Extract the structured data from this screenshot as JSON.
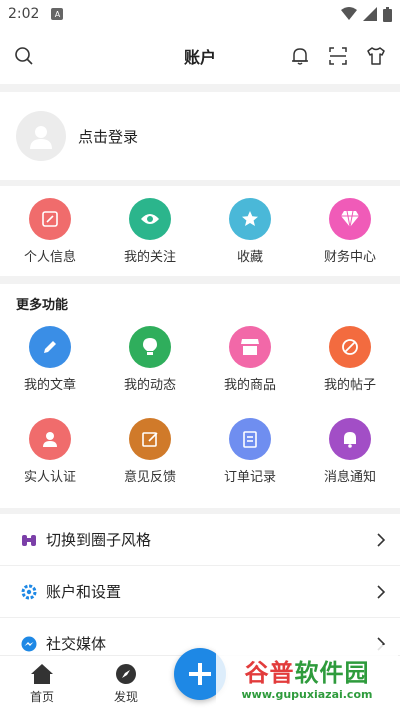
{
  "status": {
    "time": "2:02",
    "app_badge": "A"
  },
  "header": {
    "title": "账户"
  },
  "login": {
    "label": "点击登录"
  },
  "quick": [
    {
      "label": "个人信息",
      "icon": "edit-icon",
      "color": "#f06c6c"
    },
    {
      "label": "我的关注",
      "icon": "eye-icon",
      "color": "#2bb58c"
    },
    {
      "label": "收藏",
      "icon": "star-icon",
      "color": "#4ab8d8"
    },
    {
      "label": "财务中心",
      "icon": "diamond-icon",
      "color": "#f05bb8"
    }
  ],
  "more": {
    "title": "更多功能",
    "items": [
      {
        "label": "我的文章",
        "icon": "pencil-icon",
        "color": "#3a8ee6"
      },
      {
        "label": "我的动态",
        "icon": "bulb-icon",
        "color": "#2fae5c"
      },
      {
        "label": "我的商品",
        "icon": "store-icon",
        "color": "#f268a8"
      },
      {
        "label": "我的帖子",
        "icon": "tag-icon",
        "color": "#f36b3f"
      },
      {
        "label": "实人认证",
        "icon": "user-id-icon",
        "color": "#f06c6c"
      },
      {
        "label": "意见反馈",
        "icon": "feedback-icon",
        "color": "#d07a2a"
      },
      {
        "label": "订单记录",
        "icon": "clipboard-icon",
        "color": "#6f8ef0"
      },
      {
        "label": "消息通知",
        "icon": "bell-icon",
        "color": "#a24ec6"
      }
    ]
  },
  "list": [
    {
      "label": "切换到圈子风格",
      "icon": "binoculars-icon"
    },
    {
      "label": "账户和设置",
      "icon": "gear-icon"
    },
    {
      "label": "社交媒体",
      "icon": "messenger-icon"
    }
  ],
  "bottom": {
    "home": "首页",
    "discover": "发现"
  },
  "watermark": {
    "line1_a": "谷普",
    "line1_b": "软件园",
    "line2": "www.gupuxiazai.com"
  }
}
